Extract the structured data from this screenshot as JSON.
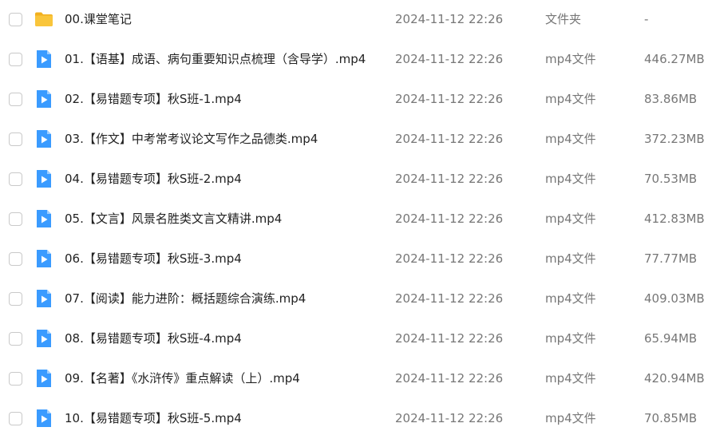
{
  "files": [
    {
      "name": "00.课堂笔记",
      "date": "2024-11-12 22:26",
      "type": "文件夹",
      "size": "-",
      "icon": "folder-icon"
    },
    {
      "name": "01.【语基】成语、病句重要知识点梳理（含导学）.mp4",
      "date": "2024-11-12 22:26",
      "type": "mp4文件",
      "size": "446.27MB",
      "icon": "video-file-icon"
    },
    {
      "name": "02.【易错题专项】秋S班-1.mp4",
      "date": "2024-11-12 22:26",
      "type": "mp4文件",
      "size": "83.86MB",
      "icon": "video-file-icon"
    },
    {
      "name": "03.【作文】中考常考议论文写作之品德类.mp4",
      "date": "2024-11-12 22:26",
      "type": "mp4文件",
      "size": "372.23MB",
      "icon": "video-file-icon"
    },
    {
      "name": "04.【易错题专项】秋S班-2.mp4",
      "date": "2024-11-12 22:26",
      "type": "mp4文件",
      "size": "70.53MB",
      "icon": "video-file-icon"
    },
    {
      "name": "05.【文言】风景名胜类文言文精讲.mp4",
      "date": "2024-11-12 22:26",
      "type": "mp4文件",
      "size": "412.83MB",
      "icon": "video-file-icon"
    },
    {
      "name": "06.【易错题专项】秋S班-3.mp4",
      "date": "2024-11-12 22:26",
      "type": "mp4文件",
      "size": "77.77MB",
      "icon": "video-file-icon"
    },
    {
      "name": "07.【阅读】能力进阶：概括题综合演练.mp4",
      "date": "2024-11-12 22:26",
      "type": "mp4文件",
      "size": "409.03MB",
      "icon": "video-file-icon"
    },
    {
      "name": "08.【易错题专项】秋S班-4.mp4",
      "date": "2024-11-12 22:26",
      "type": "mp4文件",
      "size": "65.94MB",
      "icon": "video-file-icon"
    },
    {
      "name": "09.【名著】《水浒传》重点解读（上）.mp4",
      "date": "2024-11-12 22:26",
      "type": "mp4文件",
      "size": "420.94MB",
      "icon": "video-file-icon"
    },
    {
      "name": "10.【易错题专项】秋S班-5.mp4",
      "date": "2024-11-12 22:26",
      "type": "mp4文件",
      "size": "70.85MB",
      "icon": "video-file-icon"
    }
  ],
  "colors": {
    "folder": "#f9c53b",
    "folder_dark": "#f2b01e",
    "video": "#3a9bff",
    "video_fold": "#9fcfff"
  }
}
